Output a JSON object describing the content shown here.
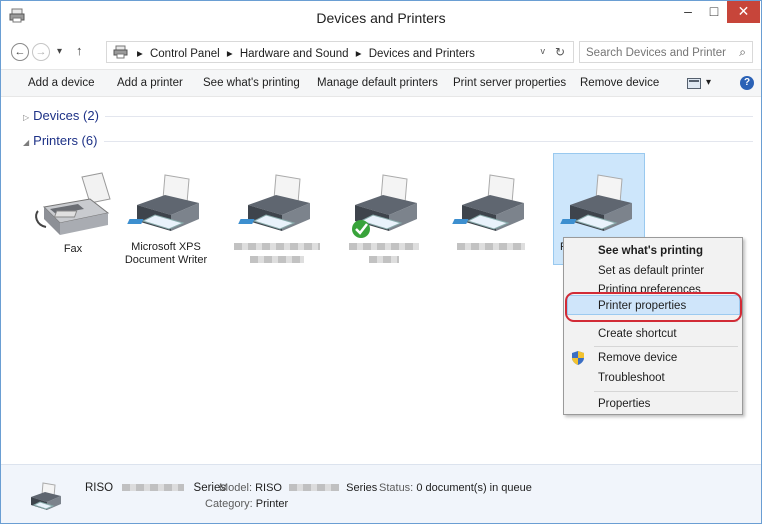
{
  "window": {
    "title": "Devices and Printers",
    "minimize_glyph": "–",
    "maximize_glyph": "□",
    "close_glyph": "✕"
  },
  "address": {
    "back_glyph": "←",
    "forward_glyph": "→",
    "history_glyph": "▾",
    "up_glyph": "↑",
    "crumbs": [
      "Control Panel",
      "Hardware and Sound",
      "Devices and Printers"
    ],
    "separator": "▸",
    "dropdown_glyph": "v",
    "refresh_glyph": "↻",
    "search_placeholder": "Search Devices and Printers",
    "search_glyph": "⌕"
  },
  "toolbar": {
    "commands": [
      "Add a device",
      "Add a printer",
      "See what's printing",
      "Manage default printers",
      "Print server properties",
      "Remove device"
    ],
    "view_glyph": "▾",
    "help_glyph": "?"
  },
  "groups": {
    "devices": {
      "label": "Devices (2)",
      "glyph": "▷"
    },
    "printers": {
      "label": "Printers (6)",
      "glyph": "◢"
    }
  },
  "printers": [
    {
      "name": "Fax",
      "icon": "fax-icon"
    },
    {
      "name_line1": "Microsoft XPS",
      "name_line2": "Document Writer",
      "icon": "printer-icon"
    },
    {
      "name": "",
      "icon": "printer-icon"
    },
    {
      "name": "",
      "icon": "printer-icon",
      "default": true
    },
    {
      "name": "",
      "icon": "printer-icon"
    },
    {
      "name": "R",
      "icon": "printer-icon",
      "selected": true
    }
  ],
  "context_menu": {
    "items": [
      "See what's printing",
      "Set as default printer",
      "Printing preferences",
      "Printer properties",
      "Create shortcut",
      "Remove device",
      "Troubleshoot",
      "Properties"
    ],
    "highlight_color": "#d22b36"
  },
  "details": {
    "name_prefix": "RISO",
    "name_suffix": "Series",
    "model_label": "Model:",
    "model_prefix": "RISO",
    "model_suffix": "Series",
    "status_label": "Status:",
    "status_value": "0 document(s) in queue",
    "category_label": "Category:",
    "category_value": "Printer"
  }
}
